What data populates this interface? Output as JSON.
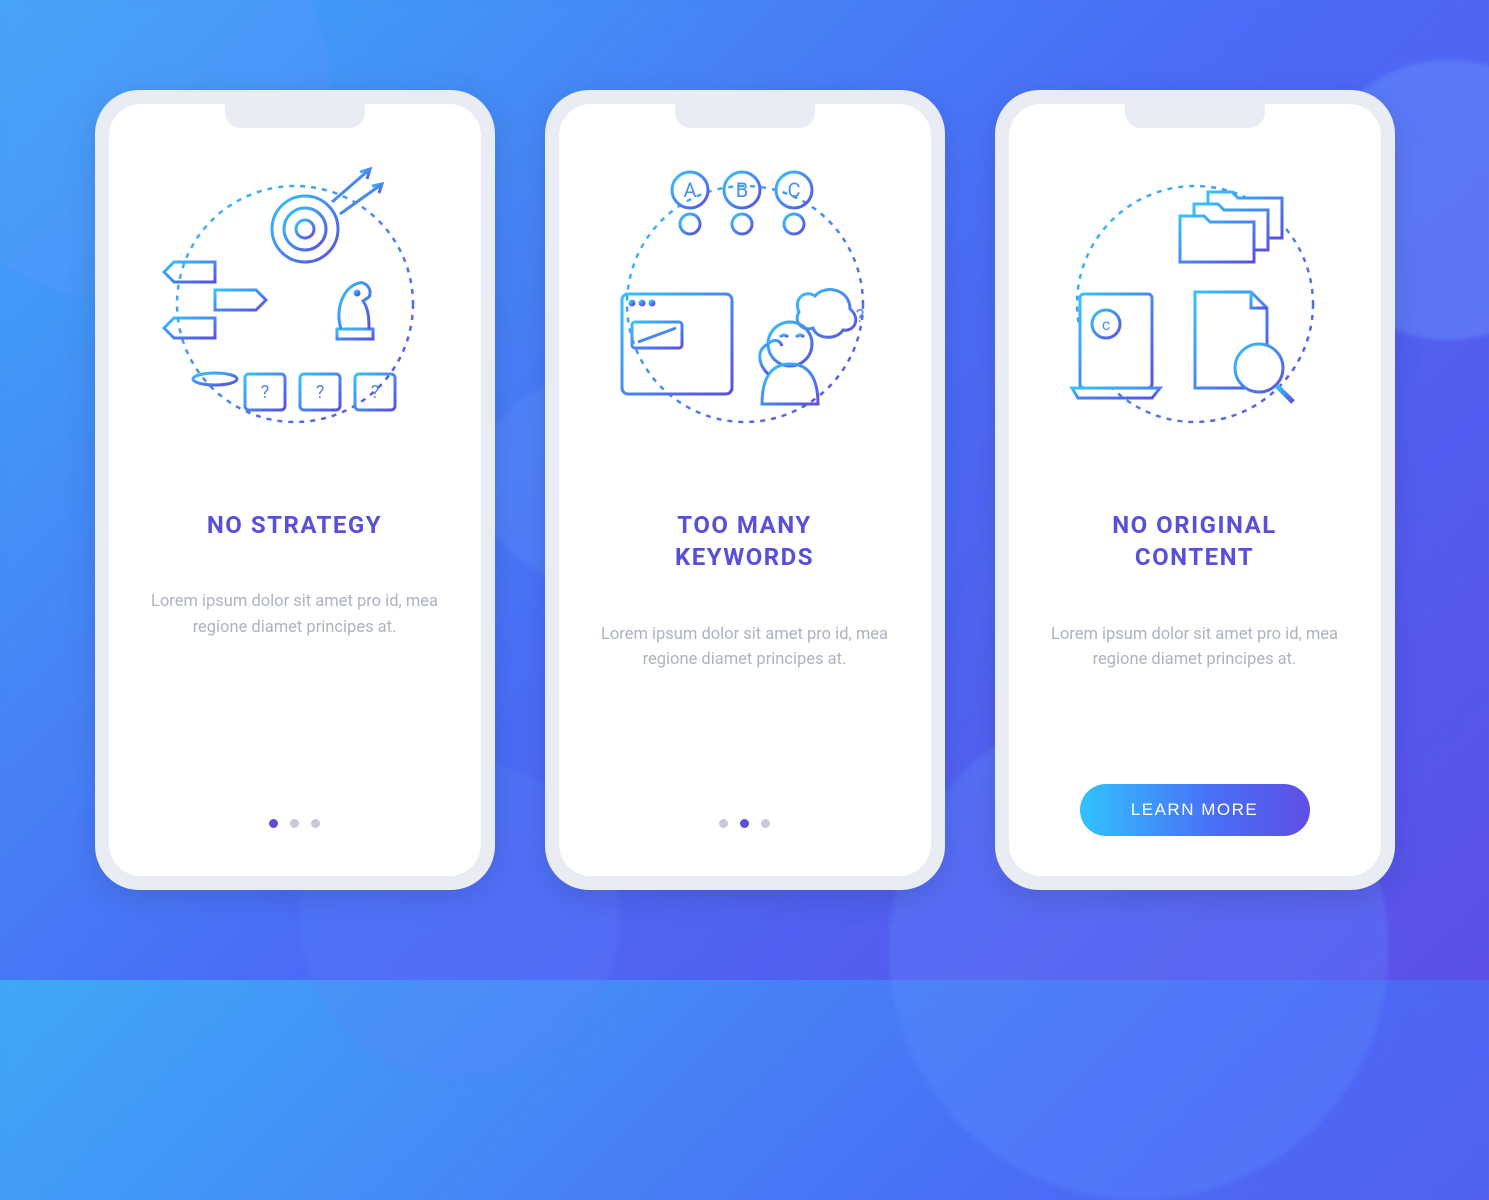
{
  "screens": [
    {
      "title": "NO STRATEGY",
      "body": "Lorem ipsum dolor sit amet pro id, mea regione diamet principes at.",
      "indicator_active": 0,
      "has_cta": false,
      "icon_name": "strategy-illustration"
    },
    {
      "title": "TOO MANY KEYWORDS",
      "body": "Lorem ipsum dolor sit amet pro id, mea regione diamet principes at.",
      "indicator_active": 1,
      "has_cta": false,
      "icon_name": "keywords-illustration"
    },
    {
      "title": "NO ORIGINAL CONTENT",
      "body": "Lorem ipsum dolor sit amet pro id, mea regione diamet principes at.",
      "indicator_active": 2,
      "has_cta": true,
      "icon_name": "content-illustration"
    }
  ],
  "cta_label": "LEARN MORE",
  "indicator_count": 3
}
